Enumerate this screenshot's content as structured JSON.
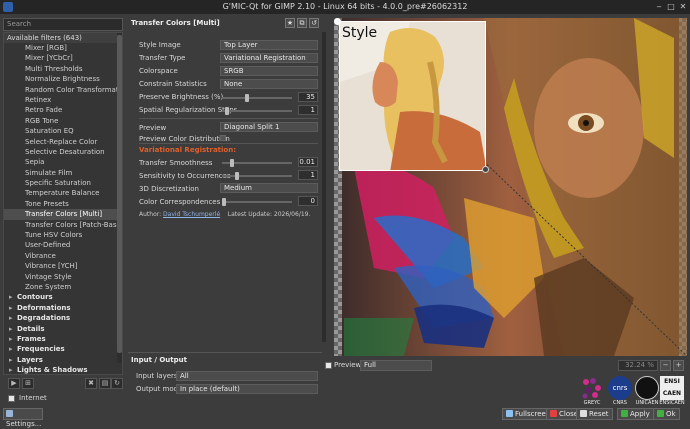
{
  "window": {
    "title": "G'MIC-Qt for GIMP 2.10 - Linux 64 bits - 4.0.0_pre#26062312"
  },
  "search": {
    "placeholder": "Search"
  },
  "filters": {
    "header": "Available filters (643)",
    "items": [
      "Mixer [RGB]",
      "Mixer [YCbCr]",
      "Multi Thresholds",
      "Normalize Brightness",
      "Random Color Transformation",
      "Retinex",
      "Retro Fade",
      "RGB Tone",
      "Saturation EQ",
      "Select-Replace Color",
      "Selective Desaturation",
      "Sepia",
      "Simulate Film",
      "Specific Saturation",
      "Temperature Balance",
      "Tone Presets",
      "Transfer Colors [Multi]",
      "Transfer Colors [Patch-Based]",
      "Tune HSV Colors",
      "User-Defined",
      "Vibrance",
      "Vibrance [YCH]",
      "Vintage Style",
      "Zone System"
    ],
    "selected": "Transfer Colors [Multi]",
    "categories": [
      "Contours",
      "Deformations",
      "Degradations",
      "Details",
      "Frames",
      "Frequencies",
      "Layers",
      "Lights & Shadows"
    ]
  },
  "bottom_left": {
    "internet_label": "Internet",
    "settings_label": "Settings..."
  },
  "filter": {
    "title": "Transfer Colors [Multi]",
    "params": {
      "style_image": {
        "label": "Style Image",
        "value": "Top Layer"
      },
      "transfer_type": {
        "label": "Transfer Type",
        "value": "Variational Registration"
      },
      "colorspace": {
        "label": "Colorspace",
        "value": "SRGB"
      },
      "constrain": {
        "label": "Constrain Statistics",
        "value": "None"
      },
      "brightness": {
        "label": "Preserve Brightness (%)",
        "value": "35",
        "level": 0.35
      },
      "spatial": {
        "label": "Spatial Regularization Steps",
        "value": "1",
        "level": 0.05
      },
      "preview": {
        "label": "Preview",
        "value": "Diagonal Split 1"
      },
      "preview_dist": {
        "label": "Preview Color Distribution"
      },
      "section": "Variational Registration:",
      "smoothness": {
        "label": "Transfer Smoothness",
        "value": "0.01",
        "level": 0.12
      },
      "sensitivity": {
        "label": "Sensitivity to Occurrences",
        "value": "1",
        "level": 0.2
      },
      "discretization": {
        "label": "3D Discretization",
        "value": "Medium"
      },
      "correspondences": {
        "label": "Color Correspondences",
        "value": "0",
        "level": 0.0
      }
    },
    "author_prefix": "Author: ",
    "author": "David Tschumperlé",
    "update": "Latest Update: 2026/06/19."
  },
  "io": {
    "title": "Input / Output",
    "input_label": "Input layers",
    "input_value": "All",
    "output_label": "Output mode",
    "output_value": "In place (default)"
  },
  "preview": {
    "style_label": "Style",
    "checkbox_label": "Preview",
    "mode": "Full",
    "zoom": "32.24 %"
  },
  "logos": [
    "GREYC",
    "CNRS",
    "UNICAEN",
    "ENSICAEN"
  ],
  "logo_text": {
    "cnrs": "cnrs",
    "ensi": "ENSI",
    "caen": "CAEN"
  },
  "buttons": {
    "fullscreen": "Fullscreen",
    "close": "Close",
    "reset": "Reset",
    "apply": "Apply",
    "ok": "Ok"
  },
  "colors": {
    "accent": "#e0602c",
    "bg": "#3c3c3c"
  }
}
